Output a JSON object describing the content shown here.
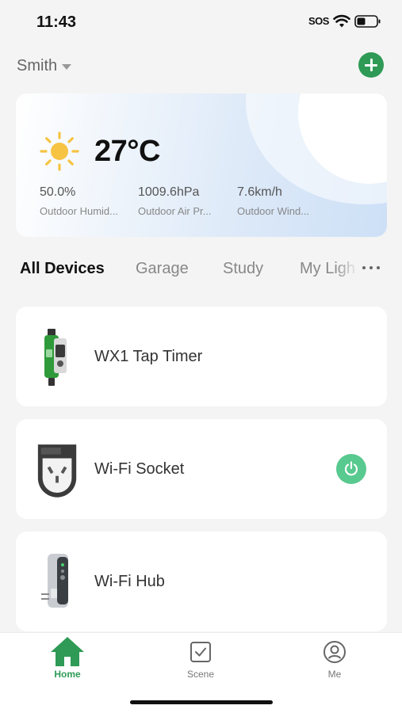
{
  "status_bar": {
    "time": "11:43",
    "sos": "SOS"
  },
  "header": {
    "home_name": "Smith"
  },
  "weather": {
    "temperature": "27°C",
    "stats": [
      {
        "value": "50.0%",
        "label": "Outdoor Humid..."
      },
      {
        "value": "1009.6hPa",
        "label": "Outdoor Air Pr..."
      },
      {
        "value": "7.6km/h",
        "label": "Outdoor Wind..."
      }
    ]
  },
  "tabs": [
    {
      "label": "All Devices",
      "active": true
    },
    {
      "label": "Garage",
      "active": false
    },
    {
      "label": "Study",
      "active": false
    },
    {
      "label": "My Ligh",
      "active": false
    }
  ],
  "devices": [
    {
      "name": "WX1 Tap Timer",
      "icon": "tap-timer-image"
    },
    {
      "name": "Wi-Fi Socket",
      "icon": "socket-image",
      "power_on": true
    },
    {
      "name": "Wi-Fi Hub",
      "icon": "hub-image"
    }
  ],
  "nav": [
    {
      "label": "Home",
      "active": true
    },
    {
      "label": "Scene",
      "active": false
    },
    {
      "label": "Me",
      "active": false
    }
  ],
  "colors": {
    "accent": "#2e9a55",
    "power": "#58c98f"
  }
}
